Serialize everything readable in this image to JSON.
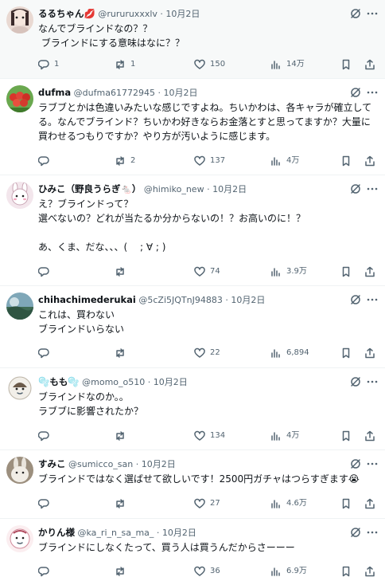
{
  "posts": [
    {
      "name": "るるちゃん💋",
      "handle": "@rururuxxxlv",
      "date": "10月2日",
      "text": "なんでブラインドなの？？\n ブラインドにする意味はなに？？",
      "replies": "1",
      "retweets": "1",
      "likes": "150",
      "views": "14万",
      "avatar": "avatar-doll"
    },
    {
      "name": "dufma",
      "handle": "@dufma61772945",
      "date": "10月2日",
      "text": "ラブブとかは色違いみたいな感じですよね。ちいかわは、各キャラが確立してる。なんでブラインド？ちいかわ好きならお金落とすと思ってますか？大量に買わせるつもりですか？やり方が汚いように感じます。",
      "replies": "",
      "retweets": "2",
      "likes": "137",
      "views": "4万",
      "avatar": "avatar-tomatoes"
    },
    {
      "name": "ひみこ（野良うらぎ🐁）",
      "handle": "@himiko_new",
      "date": "10月2日",
      "text": "え？ブラインドって？\n選べないの？どれが当たるか分からないの！？お高いのに！？\n\nあ、くま、だな、、、(　 ; ∀ ; )",
      "replies": "",
      "retweets": "",
      "likes": "74",
      "views": "3.9万",
      "avatar": "avatar-rabbit"
    },
    {
      "name": "chihachimederukai",
      "handle": "@5cZi5JQTnJ94883",
      "date": "10月2日",
      "text": "これは、買わない\nブラインドいらない",
      "replies": "",
      "retweets": "",
      "likes": "22",
      "views": "6,894",
      "avatar": "avatar-scenery"
    },
    {
      "name": "🫧もも🫧",
      "handle": "@momo_o510",
      "date": "10月2日",
      "text": "ブラインドなのか。。\nラブブに影響されたか？",
      "replies": "",
      "retweets": "",
      "likes": "134",
      "views": "4万",
      "avatar": "avatar-character"
    },
    {
      "name": "すみこ",
      "handle": "@sumicco_san",
      "date": "10月2日",
      "text": "ブラインドではなく選ばせて欲しいです！2500円ガチャはつらすぎます😭",
      "replies": "",
      "retweets": "",
      "likes": "27",
      "views": "4.6万",
      "avatar": "avatar-rabbit-photo"
    },
    {
      "name": "かりん様",
      "handle": "@ka_ri_n_sa_ma_",
      "date": "10月2日",
      "text": "ブラインドにしなくたって、買う人は買うんだからさーーー",
      "replies": "",
      "retweets": "",
      "likes": "36",
      "views": "6.9万",
      "avatar": "avatar-illustration"
    }
  ],
  "colors": {
    "text": "#0f1419",
    "muted": "#536471",
    "divider": "#eff3f4",
    "highlight_bg": "#f7f9f9"
  },
  "icons": [
    "reply-icon",
    "retweet-icon",
    "like-icon",
    "views-icon",
    "bookmark-icon",
    "share-icon",
    "grok-icon",
    "more-icon"
  ]
}
